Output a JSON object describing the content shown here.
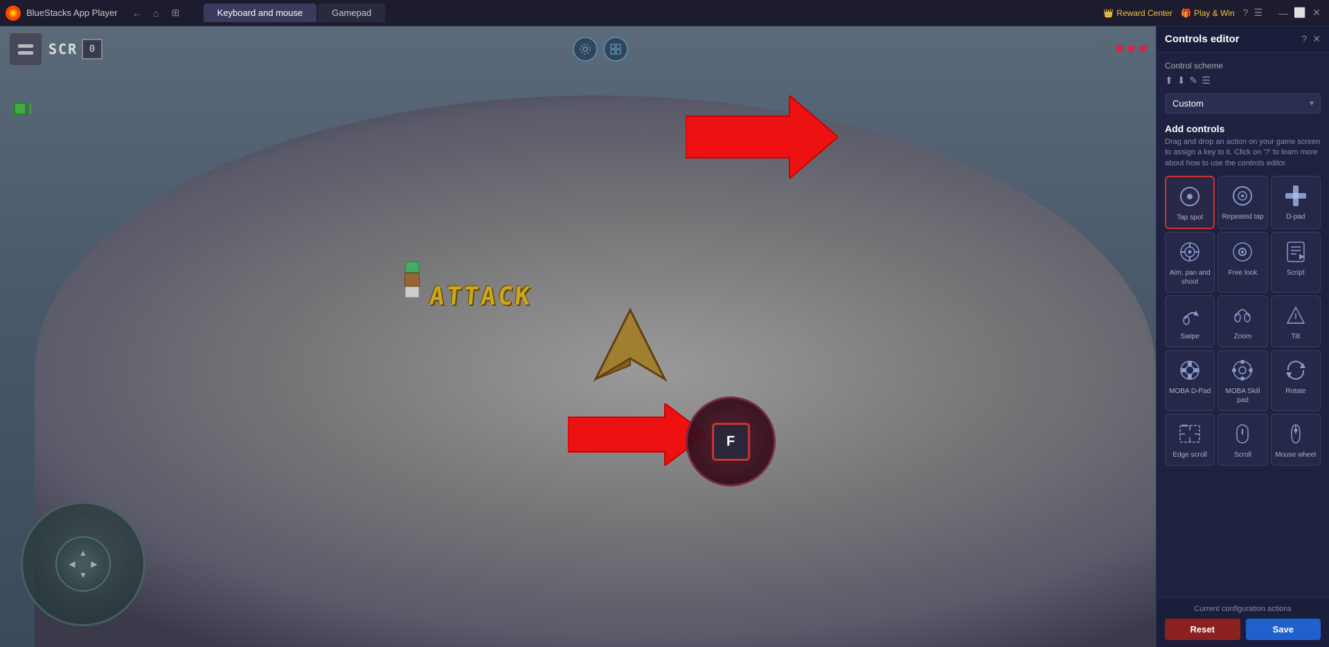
{
  "app": {
    "name": "BlueStacks App Player",
    "logo_text": "BS"
  },
  "title_bar": {
    "tabs": [
      {
        "label": "Keyboard and mouse",
        "active": true
      },
      {
        "label": "Gamepad",
        "active": false
      }
    ],
    "reward_center": "Reward Center",
    "play_win": "Play & Win",
    "nav_back": "←",
    "nav_home": "⌂",
    "nav_windows": "⊞",
    "icon_question": "?",
    "icon_menu": "☰",
    "icon_minimize": "—",
    "icon_maximize": "⬜",
    "icon_close": "✕"
  },
  "hud": {
    "score_label": "SCR",
    "score_value": "0",
    "hearts": [
      "empty",
      "full",
      "full",
      "full"
    ],
    "center_icon1": "⚙",
    "center_icon2": "⊞"
  },
  "game": {
    "attack_text": "ATTACK",
    "interact_key": "F"
  },
  "controls_editor": {
    "title": "Controls editor",
    "icon_question": "?",
    "icon_close": "✕",
    "control_scheme_label": "Control scheme",
    "scheme_icons": [
      "⬆",
      "⬇",
      "✎",
      "☰"
    ],
    "scheme_value": "Custom",
    "add_controls_title": "Add controls",
    "add_controls_desc": "Drag and drop an action on your game screen to assign a key to it. Click on '?' to learn more about how to use the controls editor.",
    "controls": [
      {
        "id": "tap-spot",
        "label": "Tap spot",
        "icon": "○",
        "highlighted": true
      },
      {
        "id": "repeated-tap",
        "label": "Repeated tap",
        "icon": "⊙"
      },
      {
        "id": "d-pad",
        "label": "D-pad",
        "icon": "✛"
      },
      {
        "id": "aim-pan-shoot",
        "label": "Aim, pan and shoot",
        "icon": "◎"
      },
      {
        "id": "free-look",
        "label": "Free look",
        "icon": "◉"
      },
      {
        "id": "script",
        "label": "Script",
        "icon": "◈"
      },
      {
        "id": "swipe",
        "label": "Swipe",
        "icon": "☞"
      },
      {
        "id": "zoom",
        "label": "Zoom",
        "icon": "✋"
      },
      {
        "id": "tilt",
        "label": "Tilt",
        "icon": "⬡"
      },
      {
        "id": "moba-d-pad",
        "label": "MOBA D-Pad",
        "icon": "⊕"
      },
      {
        "id": "moba-skill-pad",
        "label": "MOBA Skill pad",
        "icon": "⊛"
      },
      {
        "id": "rotate",
        "label": "Rotate",
        "icon": "↺"
      },
      {
        "id": "edge-scroll",
        "label": "Edge scroll",
        "icon": "⬚"
      },
      {
        "id": "scroll",
        "label": "Scroll",
        "icon": "▭"
      },
      {
        "id": "mouse-wheel",
        "label": "Mouse wheel",
        "icon": "⊜"
      }
    ],
    "footer_label": "Current configuration actions",
    "btn_reset": "Reset",
    "btn_save": "Save"
  }
}
